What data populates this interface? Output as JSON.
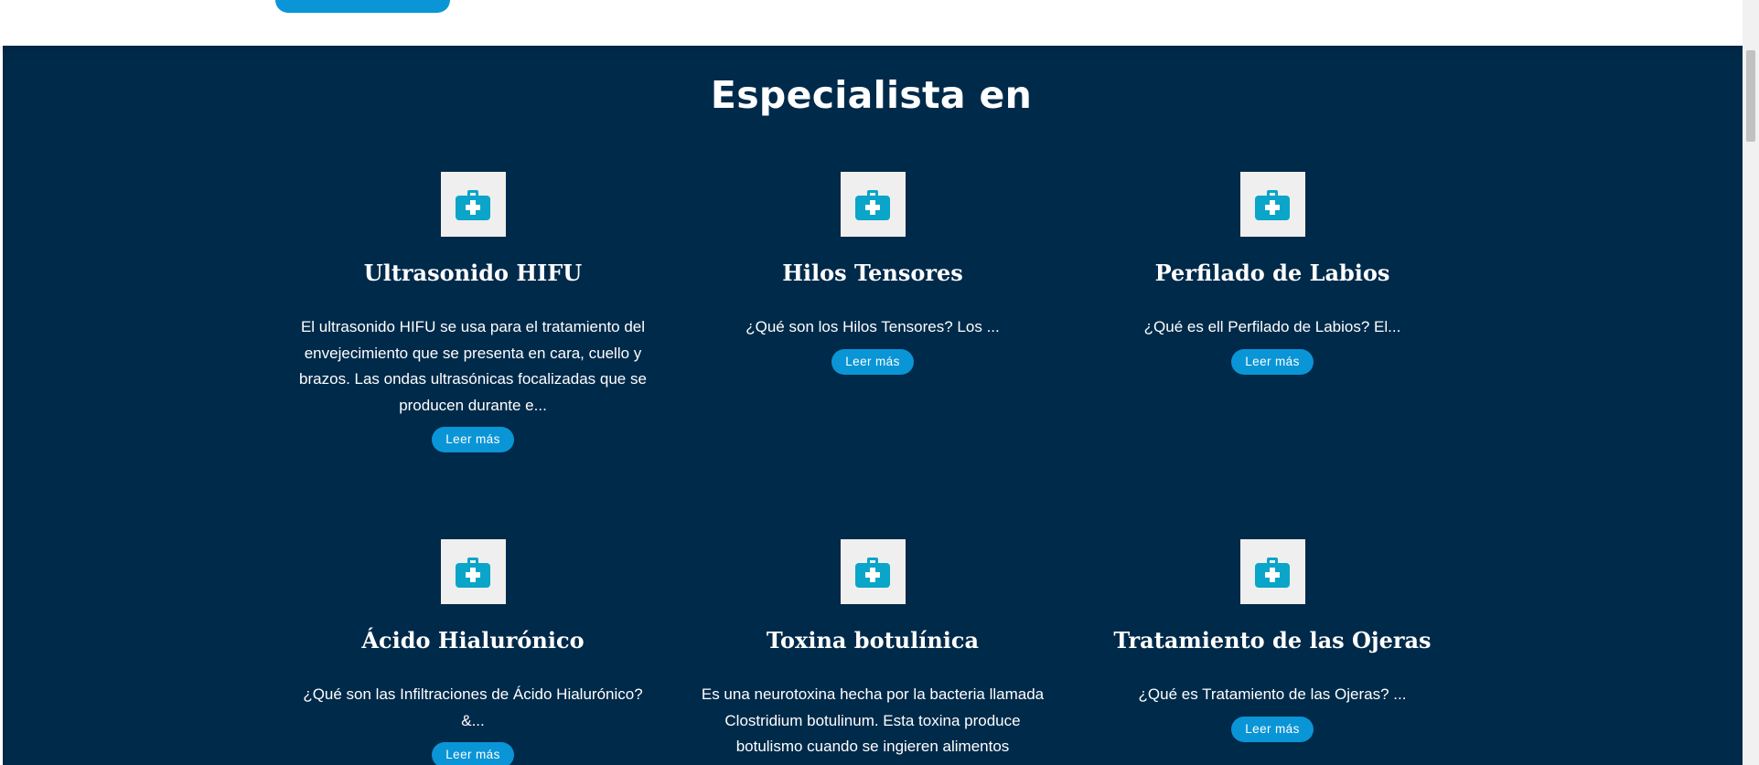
{
  "section": {
    "title": "Especialista en",
    "icon": "medkit-icon",
    "colors": {
      "background": "#002a4a",
      "accent": "#0a95d6",
      "icon": "#0aa5c8",
      "icon_box": "#efefef"
    }
  },
  "cards": [
    {
      "title": "Ultrasonido HIFU",
      "text": "El ultrasonido HIFU se usa para el tratamiento del envejecimiento que se presenta en cara, cuello y brazos. Las ondas ultrasónicas focalizadas que se producen durante e...",
      "button": "Leer más"
    },
    {
      "title": "Hilos Tensores",
      "text": "¿Qué son los Hilos Tensores?  Los ...",
      "button": "Leer más"
    },
    {
      "title": "Perfilado de Labios",
      "text": "¿Qué es ell Perfilado de Labios?  El...",
      "button": "Leer más"
    },
    {
      "title": "Ácido Hialurónico",
      "text": "¿Qué son las Infiltraciones de Ácido Hialurónico? &...",
      "button": "Leer más"
    },
    {
      "title": "Toxina botulínica",
      "text": "Es una neurotoxina hecha por la bacteria llamada Clostridium botulinum. Esta toxina produce botulismo cuando se ingieren alimentos contaminados c...",
      "button": ""
    },
    {
      "title": "Tratamiento de las Ojeras",
      "text": "¿Qué es Tratamiento de las Ojeras? ...",
      "button": "Leer más"
    }
  ]
}
